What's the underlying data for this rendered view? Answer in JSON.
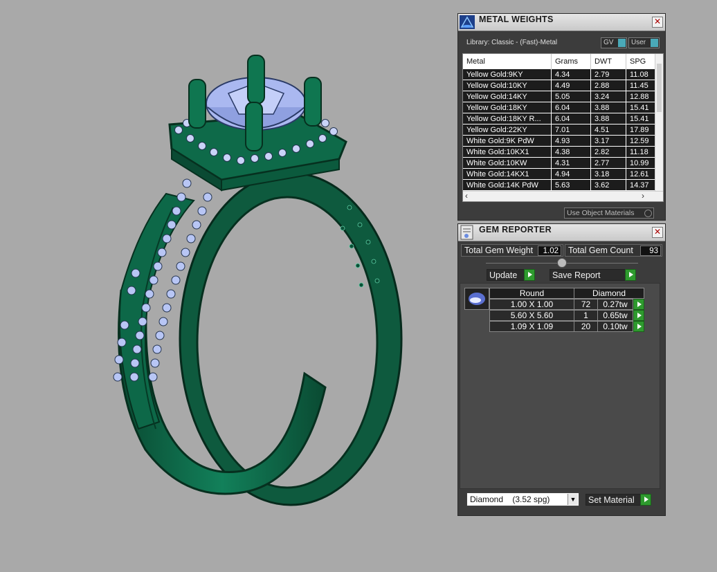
{
  "colors": {
    "background": "#a9a9a9",
    "metal_green": "#0f6b47",
    "stone_blue": "#aab8f0",
    "accent_green": "#2e9a2e"
  },
  "metal_weights": {
    "title": "METAL WEIGHTS",
    "library": "Library: Classic - (Fast)-Metal",
    "toggle_gv": "GV",
    "toggle_user": "User",
    "columns": [
      "Metal",
      "Grams",
      "DWT",
      "SPG"
    ],
    "rows": [
      [
        "Yellow Gold:9KY",
        "4.34",
        "2.79",
        "11.08"
      ],
      [
        "Yellow Gold:10KY",
        "4.49",
        "2.88",
        "11.45"
      ],
      [
        "Yellow Gold:14KY",
        "5.05",
        "3.24",
        "12.88"
      ],
      [
        "Yellow Gold:18KY",
        "6.04",
        "3.88",
        "15.41"
      ],
      [
        "Yellow Gold:18KY R...",
        "6.04",
        "3.88",
        "15.41"
      ],
      [
        "Yellow Gold:22KY",
        "7.01",
        "4.51",
        "17.89"
      ],
      [
        "White Gold:9K PdW",
        "4.93",
        "3.17",
        "12.59"
      ],
      [
        "White Gold:10KX1",
        "4.38",
        "2.82",
        "11.18"
      ],
      [
        "White Gold:10KW",
        "4.31",
        "2.77",
        "10.99"
      ],
      [
        "White Gold:14KX1",
        "4.94",
        "3.18",
        "12.61"
      ],
      [
        "White Gold:14K PdW",
        "5.63",
        "3.62",
        "14.37"
      ]
    ],
    "use_object_materials": "Use Object Materials"
  },
  "gem_reporter": {
    "title": "GEM REPORTER",
    "total_weight_label": "Total Gem Weight",
    "total_weight_value": "1.02",
    "total_count_label": "Total Gem Count",
    "total_count_value": "93",
    "update_label": "Update",
    "save_report_label": "Save Report",
    "table_headers": [
      "Round",
      "Diamond"
    ],
    "gems": [
      {
        "size": "1.00 X 1.00",
        "count": "72",
        "weight": "0.27tw"
      },
      {
        "size": "5.60 X 5.60",
        "count": "1",
        "weight": "0.65tw"
      },
      {
        "size": "1.09 X 1.09",
        "count": "20",
        "weight": "0.10tw"
      }
    ],
    "material_select": "Diamond    (3.52 spg)",
    "set_material_label": "Set Material"
  }
}
